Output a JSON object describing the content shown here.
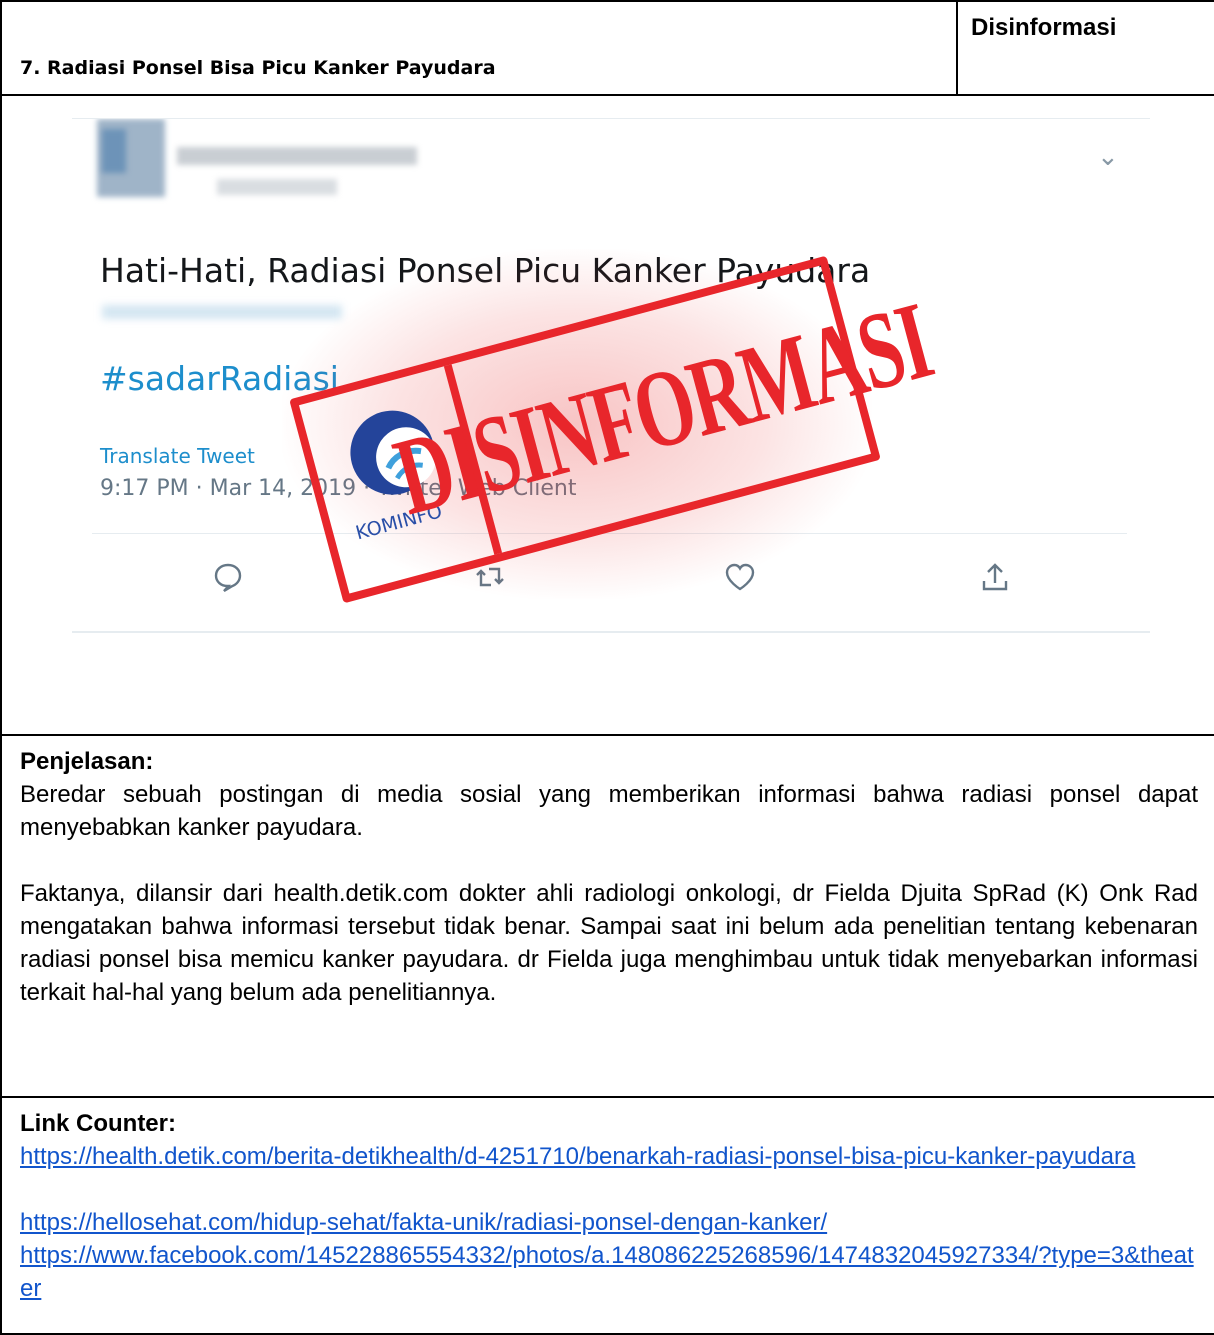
{
  "header": {
    "title": "7. Radiasi Ponsel Bisa Picu Kanker Payudara",
    "label": "Disinformasi"
  },
  "tweet": {
    "text": "Hati-Hati, Radiasi Ponsel Picu Kanker Payudara",
    "hashtag": "#sadarRadiasi",
    "translate": "Translate Tweet",
    "meta": "9:17 PM · Mar 14, 2019 · Twitter Web Client"
  },
  "stamp": {
    "word": "DISINFORMASI",
    "logo_text": "KOMINFO",
    "color": "#e8262b"
  },
  "explanation": {
    "heading": "Penjelasan:",
    "p1": "Beredar sebuah postingan di media sosial yang memberikan informasi bahwa radiasi ponsel dapat menyebabkan kanker payudara.",
    "p2": "Faktanya, dilansir dari health.detik.com dokter ahli radiologi onkologi, dr Fielda Djuita SpRad (K) Onk Rad mengatakan bahwa informasi tersebut tidak benar. Sampai saat ini belum ada penelitian tentang kebenaran radiasi ponsel bisa memicu kanker payudara. dr Fielda juga menghimbau untuk tidak menyebarkan informasi terkait hal-hal yang belum ada penelitiannya."
  },
  "links": {
    "heading": "Link Counter:",
    "items": [
      "https://health.detik.com/berita-detikhealth/d-4251710/benarkah-radiasi-ponsel-bisa-picu-kanker-payudara",
      "https://hellosehat.com/hidup-sehat/fakta-unik/radiasi-ponsel-dengan-kanker/",
      "https://www.facebook.com/145228865554332/photos/a.148086225268596/1474832045927334/?type=3&theater"
    ]
  }
}
